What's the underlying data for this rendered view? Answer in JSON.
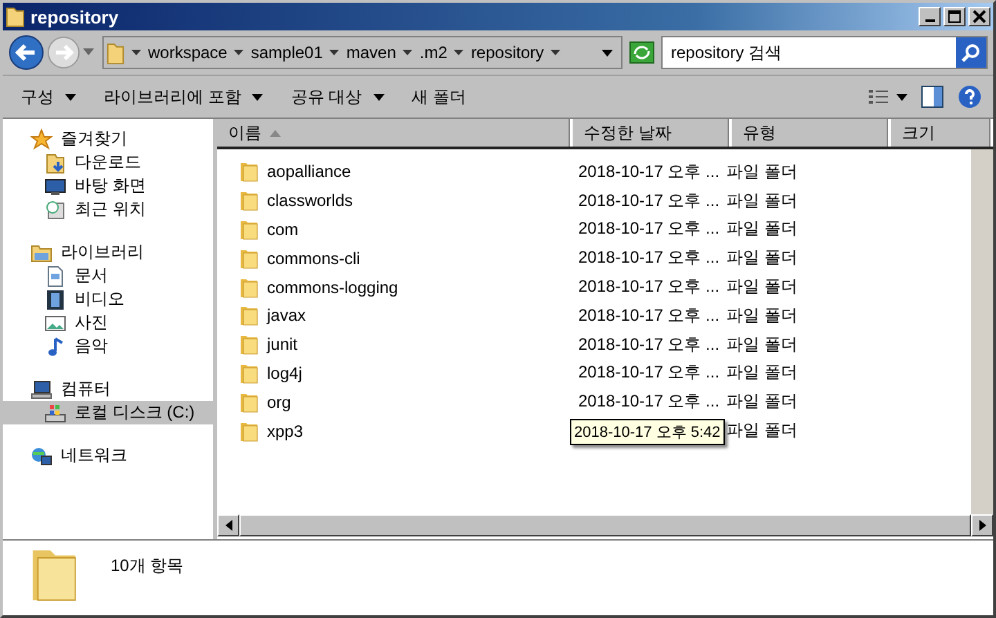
{
  "window": {
    "title": "repository"
  },
  "address": {
    "crumbs": [
      "workspace",
      "sample01",
      "maven",
      ".m2",
      "repository"
    ],
    "search_placeholder": "repository 검색"
  },
  "toolbar": {
    "items": [
      {
        "label": "구성",
        "dropdown": true
      },
      {
        "label": "라이브러리에 포함",
        "dropdown": true
      },
      {
        "label": "공유 대상",
        "dropdown": true
      },
      {
        "label": "새 폴더",
        "dropdown": false
      }
    ]
  },
  "sidebar": {
    "items": [
      {
        "label": "즐겨찾기",
        "kind": "star",
        "selected": false,
        "children": [
          {
            "label": "다운로드",
            "kind": "download",
            "selected": false
          },
          {
            "label": "바탕 화면",
            "kind": "desktop",
            "selected": false
          },
          {
            "label": "최근 위치",
            "kind": "recent",
            "selected": false
          }
        ]
      },
      {
        "label": "라이브러리",
        "kind": "library",
        "selected": false,
        "children": [
          {
            "label": "문서",
            "kind": "document",
            "selected": false
          },
          {
            "label": "비디오",
            "kind": "video",
            "selected": false
          },
          {
            "label": "사진",
            "kind": "photo",
            "selected": false
          },
          {
            "label": "음악",
            "kind": "music",
            "selected": false
          }
        ]
      },
      {
        "label": "컴퓨터",
        "kind": "computer",
        "selected": false,
        "children": [
          {
            "label": "로컬 디스크 (C:)",
            "kind": "disk",
            "selected": true
          }
        ]
      },
      {
        "label": "네트워크",
        "kind": "network",
        "selected": false
      }
    ]
  },
  "table": {
    "columns": [
      {
        "label": "이름",
        "sorted": true
      },
      {
        "label": "수정한 날짜",
        "sorted": false
      },
      {
        "label": "유형",
        "sorted": false
      },
      {
        "label": "크기",
        "sorted": false
      }
    ],
    "rows": [
      {
        "name": "aopalliance",
        "date": "2018-10-17 오후 ...",
        "type": "파일 폴더"
      },
      {
        "name": "classworlds",
        "date": "2018-10-17 오후 ...",
        "type": "파일 폴더"
      },
      {
        "name": "com",
        "date": "2018-10-17 오후 ...",
        "type": "파일 폴더"
      },
      {
        "name": "commons-cli",
        "date": "2018-10-17 오후 ...",
        "type": "파일 폴더"
      },
      {
        "name": "commons-logging",
        "date": "2018-10-17 오후 ...",
        "type": "파일 폴더"
      },
      {
        "name": "javax",
        "date": "2018-10-17 오후 ...",
        "type": "파일 폴더"
      },
      {
        "name": "junit",
        "date": "2018-10-17 오후 ...",
        "type": "파일 폴더"
      },
      {
        "name": "log4j",
        "date": "2018-10-17 오후 ...",
        "type": "파일 폴더"
      },
      {
        "name": "org",
        "date": "2018-10-17 오후 ...",
        "type": "파일 폴더"
      },
      {
        "name": "xpp3",
        "date_tooltip": "2018-10-17 오후 5:42",
        "type": "파일 폴더"
      }
    ]
  },
  "details": {
    "count": "10개 항목"
  }
}
